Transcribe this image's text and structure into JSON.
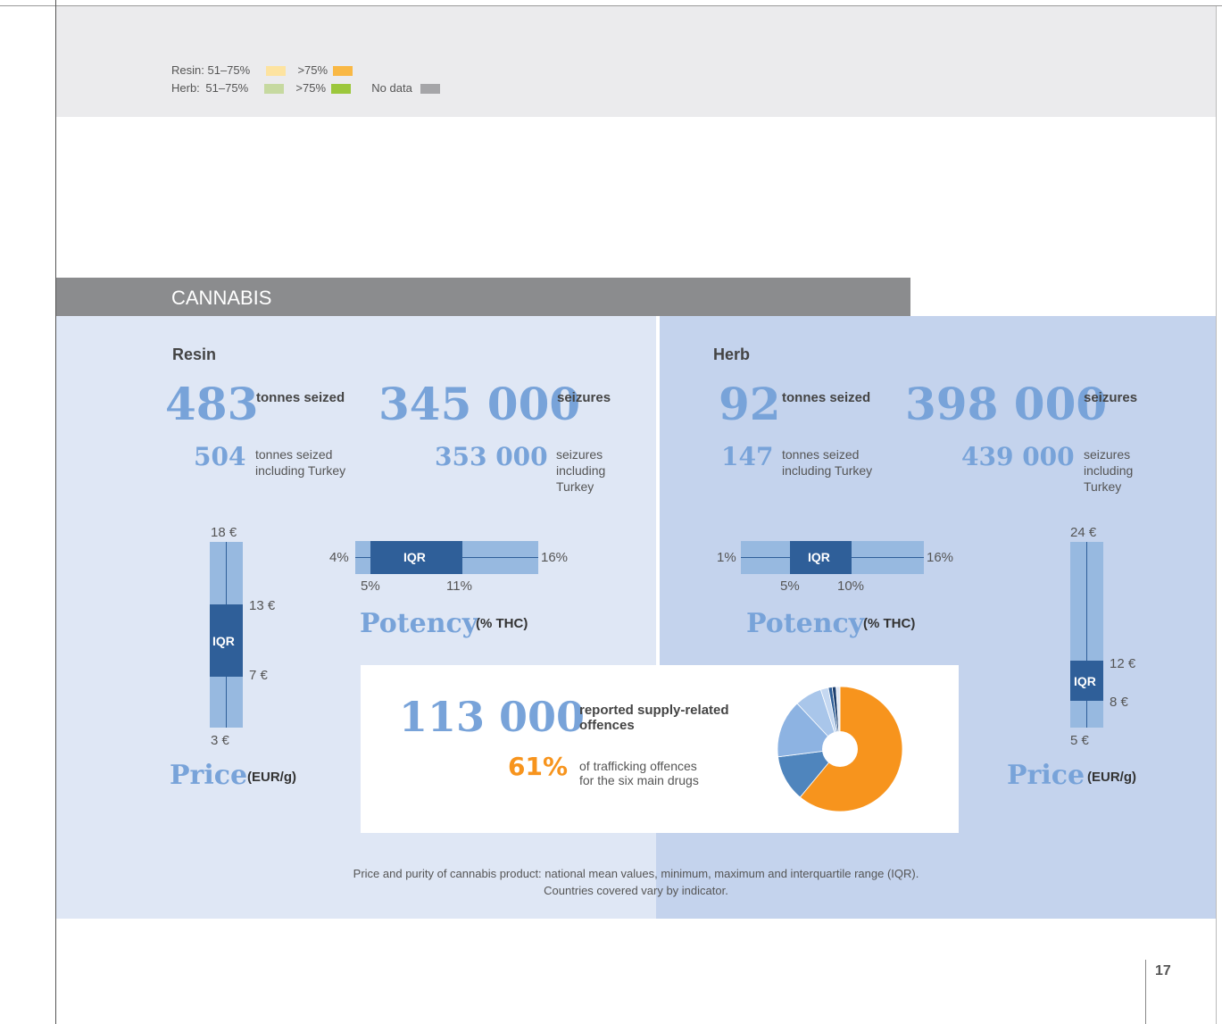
{
  "legend": {
    "resin_label": "Resin:",
    "resin_range1": "51–75%",
    "resin_range2": ">75%",
    "herb_label": "Herb:",
    "herb_range1": "51–75%",
    "herb_range2": ">75%",
    "no_data": "No data",
    "colors": {
      "resin_51_75": "#fde3a0",
      "resin_75": "#f9b845",
      "herb_51_75": "#c6d9a0",
      "herb_75": "#9cc73c",
      "no_data": "#a5a5a8"
    }
  },
  "banner": {
    "title": "CANNABIS"
  },
  "resin": {
    "label": "Resin",
    "tonnes": "483",
    "tonnes_label": "tonnes seized",
    "seizures": "345 000",
    "seizures_label": "seizures",
    "tonnes_tr": "504",
    "tonnes_tr_label_1": "tonnes seized",
    "tonnes_tr_label_2": "including Turkey",
    "seizures_tr": "353 000",
    "seizures_tr_label_1": "seizures",
    "seizures_tr_label_2": "including",
    "seizures_tr_label_3": "Turkey",
    "price": {
      "max": "18 €",
      "q3": "13 €",
      "q1": "7 €",
      "min": "3 €",
      "iqr": "IQR",
      "title": "Price",
      "unit": "(EUR/g)"
    },
    "potency": {
      "min": "4%",
      "max": "16%",
      "q1": "5%",
      "q3": "11%",
      "iqr": "IQR",
      "title": "Potency",
      "unit": "(% THC)"
    }
  },
  "herb": {
    "label": "Herb",
    "tonnes": "92",
    "tonnes_label": "tonnes seized",
    "seizures": "398 000",
    "seizures_label": "seizures",
    "tonnes_tr": "147",
    "tonnes_tr_label_1": "tonnes seized",
    "tonnes_tr_label_2": "including Turkey",
    "seizures_tr": "439 000",
    "seizures_tr_label_1": "seizures",
    "seizures_tr_label_2": "including",
    "seizures_tr_label_3": "Turkey",
    "price": {
      "max": "24 €",
      "q3": "12 €",
      "q1": "8 €",
      "min": "5 €",
      "iqr": "IQR",
      "title": "Price",
      "unit": "(EUR/g)"
    },
    "potency": {
      "min": "1%",
      "max": "16%",
      "q1": "5%",
      "q3": "10%",
      "iqr": "IQR",
      "title": "Potency",
      "unit": "(% THC)"
    }
  },
  "offences": {
    "number": "113 000",
    "label_1": "reported supply-related",
    "label_2": "offences",
    "percent": "61%",
    "pct_label_1": "of trafficking offences",
    "pct_label_2": "for the six main drugs",
    "pie_values": [
      61,
      12,
      15,
      7,
      2,
      1,
      1,
      1
    ],
    "pie_colors": [
      "#f7941d",
      "#4f85bd",
      "#8db3e2",
      "#a9c6ea",
      "#c5d8f1",
      "#2f5f99",
      "#1d3f6e",
      "#dfe7f5"
    ]
  },
  "caption": {
    "line1": "Price and purity of cannabis product: national mean values, minimum, maximum and interquartile range (IQR).",
    "line2": "Countries covered vary by indicator."
  },
  "page_number": "17"
}
